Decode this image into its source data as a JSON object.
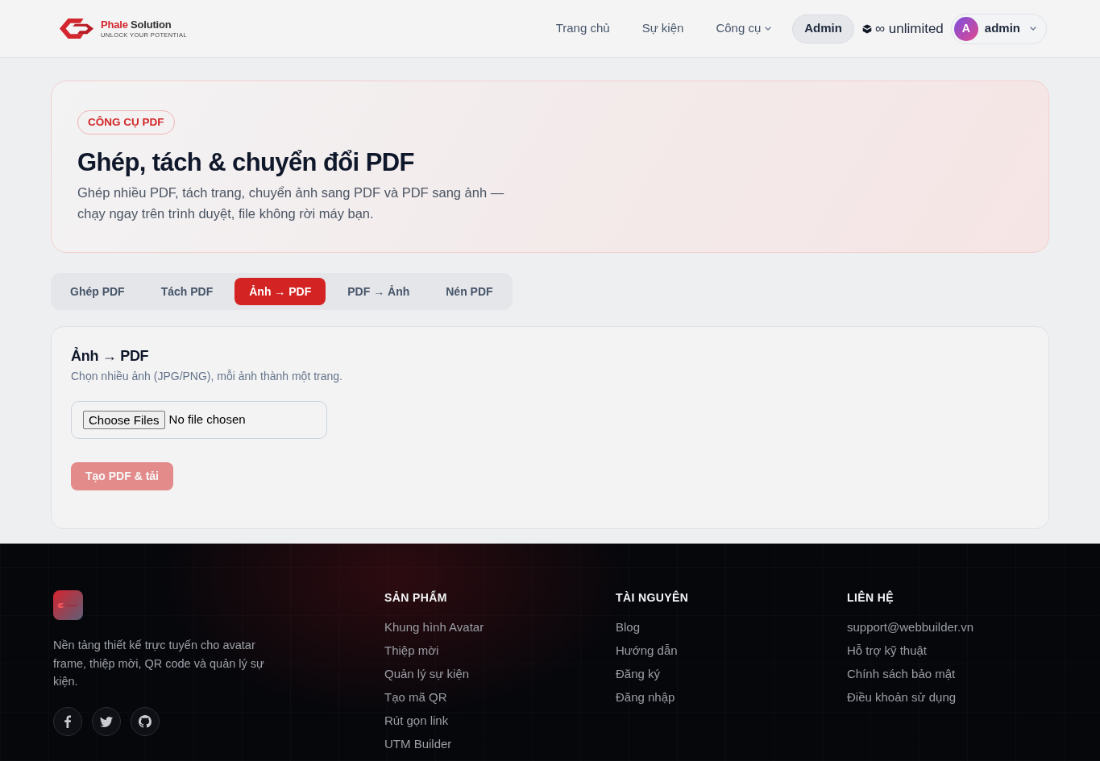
{
  "navbar": {
    "brand_first": "Phale",
    "brand_rest": "Solution",
    "tagline": "UNLOCK YOUR POTENTIAL",
    "links": [
      {
        "label": "Trang chủ",
        "kind": "link"
      },
      {
        "label": "Sự kiện",
        "kind": "link"
      },
      {
        "label": "Công cụ",
        "kind": "dropdown"
      }
    ],
    "admin_button": "Admin",
    "quota": "∞ unlimited",
    "user": {
      "avatar_letter": "A",
      "name": "admin"
    }
  },
  "hero": {
    "badge": "CÔNG CỤ PDF",
    "title": "Ghép, tách & chuyển đổi PDF",
    "subtitle": "Ghép nhiều PDF, tách trang, chuyển ảnh sang PDF và PDF sang ảnh — chạy ngay trên trình duyệt, file không rời máy bạn."
  },
  "tabs": [
    {
      "label": "Ghép PDF",
      "selected": false
    },
    {
      "label": "Tách PDF",
      "selected": false
    },
    {
      "label": "Ảnh → PDF",
      "selected": true
    },
    {
      "label": "PDF → Ảnh",
      "selected": false
    },
    {
      "label": "Nén PDF",
      "selected": false
    }
  ],
  "panel": {
    "title": "Ảnh → PDF",
    "description": "Chọn nhiều ảnh (JPG/PNG), mỗi ảnh thành một trang.",
    "file_input": {
      "button": "Choose Files",
      "status": "No file chosen"
    },
    "submit": {
      "label": "Tạo PDF & tải",
      "disabled": true
    }
  },
  "footer": {
    "description": "Nền tảng thiết kế trực tuyến cho avatar frame, thiệp mời, QR code và quản lý sự kiện.",
    "social_links": [
      {
        "kind": "facebook"
      },
      {
        "kind": "twitter"
      },
      {
        "kind": "github"
      }
    ],
    "columns": [
      {
        "heading": "SẢN PHẨM",
        "links": [
          "Khung hình Avatar",
          "Thiệp mời",
          "Quản lý sự kiện",
          "Tạo mã QR",
          "Rút gọn link",
          "UTM Builder"
        ]
      },
      {
        "heading": "TÀI NGUYÊN",
        "links": [
          "Blog",
          "Hướng dẫn",
          "Đăng ký",
          "Đăng nhập"
        ]
      },
      {
        "heading": "LIÊN HỆ",
        "links": [
          "support@webbuilder.vn",
          "Hỗ trợ kỹ thuật",
          "Chính sách bảo mật",
          "Điều khoản sử dụng"
        ]
      }
    ]
  }
}
